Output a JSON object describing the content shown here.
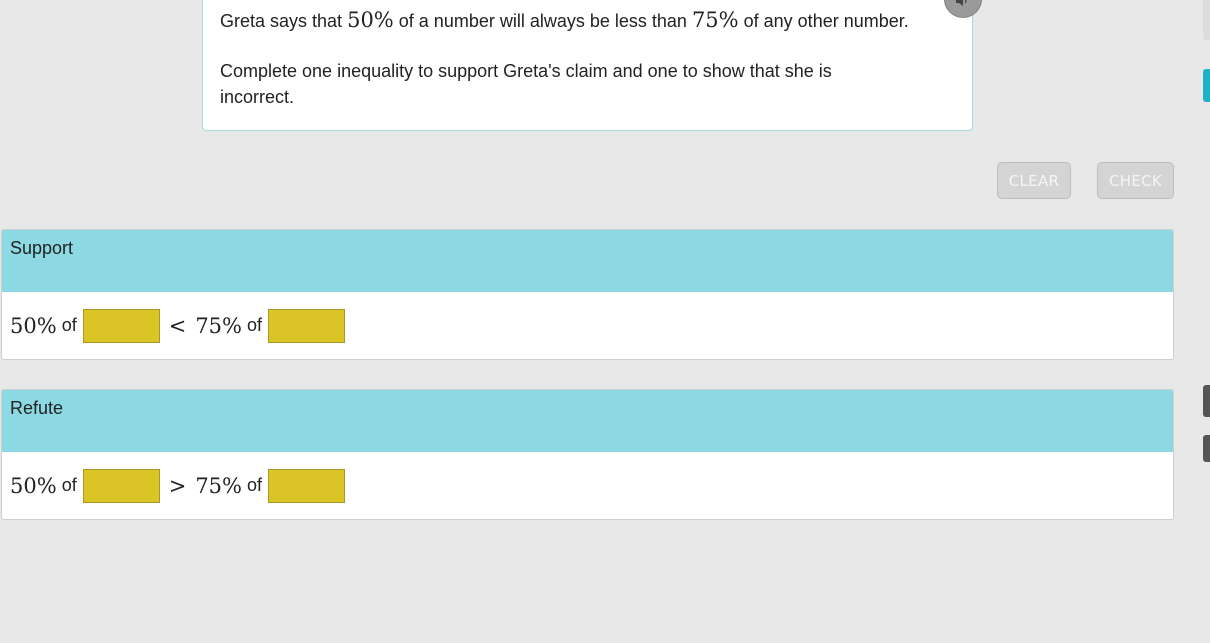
{
  "prompt": {
    "line1_a": "Greta says that",
    "pct_a": "50%",
    "line1_b": "of a number will always be less than",
    "pct_b": "75%",
    "line1_c": "of any other number.",
    "line2": "Complete one inequality to support Greta's claim and one to show that she is incorrect."
  },
  "audio": {
    "icon": "speaker-icon"
  },
  "actions": {
    "clear_label": "CLEAR",
    "check_label": "CHECK"
  },
  "support": {
    "title": "Support",
    "pct_left": "50%",
    "word_left": "of",
    "operator": "<",
    "pct_right": "75%",
    "word_right": "of",
    "left_value": "",
    "right_value": ""
  },
  "refute": {
    "title": "Refute",
    "pct_left": "50%",
    "word_left": "of",
    "operator": ">",
    "pct_right": "75%",
    "word_right": "of",
    "left_value": "",
    "right_value": ""
  },
  "colors": {
    "header_bg": "#8cd9e3",
    "answer_box": "#dbc526",
    "accent": "#1fb2c6"
  }
}
